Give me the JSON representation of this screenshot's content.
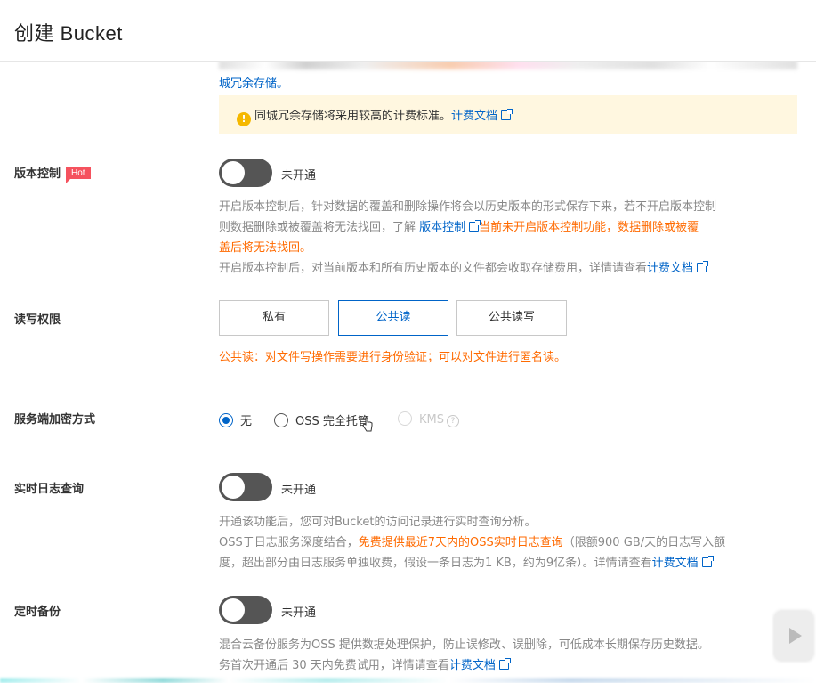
{
  "header": {
    "title": "创建 Bucket"
  },
  "redundancy": {
    "tail_text": "城冗余存储。",
    "notice_text": "同城冗余存储将采用较高的计费标准。",
    "notice_link": "计费文档"
  },
  "versioning": {
    "label": "版本控制",
    "badge": "Hot",
    "switch_state": "未开通",
    "desc1": "开启版本控制后，针对数据的覆盖和删除操作将会以历史版本的形式保存下来，若不开启版本控制",
    "desc2_a": "则数据删除或被覆盖将无法找回，了解 ",
    "desc2_link": "版本控制",
    "desc2_warn": "当前未开启版本控制功能，数据删除或被覆",
    "desc3_warn": "盖后将无法找回。",
    "desc4_a": "开启版本控制后，对当前版本和所有历史版本的文件都会收取存储费用，详情请查看",
    "desc4_link": "计费文档"
  },
  "acl": {
    "label": "读写权限",
    "options": [
      "私有",
      "公共读",
      "公共读写"
    ],
    "selected": "公共读",
    "warning": "公共读：对文件写操作需要进行身份验证；可以对文件进行匿名读。"
  },
  "encryption": {
    "label": "服务端加密方式",
    "options": [
      "无",
      "OSS 完全托管",
      "KMS"
    ],
    "selected": "无"
  },
  "realtime_log": {
    "label": "实时日志查询",
    "switch_state": "未开通",
    "desc1": "开通该功能后，您可对Bucket的访问记录进行实时查询分析。",
    "desc2_a": "OSS于日志服务深度结合，",
    "desc2_warn": "免费提供最近7天内的OSS实时日志查询",
    "desc2_b": "（限额900 GB/天的日志写入额",
    "desc3_a": "度，超出部分由日志服务单独收费，假设一条日志为1 KB，约为9亿条）。详情请查看",
    "desc3_link": "计费文档"
  },
  "backup": {
    "label": "定时备份",
    "switch_state": "未开通",
    "desc1": "混合云备份服务为OSS 提供数据处理保护，防止误修改、误删除，可低成本长期保存历史数据。",
    "desc2_a": "务首次开通后 30 天内免费试用，详情请查看",
    "desc2_link": "计费文档"
  },
  "colors": {
    "link": "#0064c8",
    "warning": "#ff6a00",
    "notice_bg": "#fff7e0",
    "hot": "#f5525e"
  }
}
